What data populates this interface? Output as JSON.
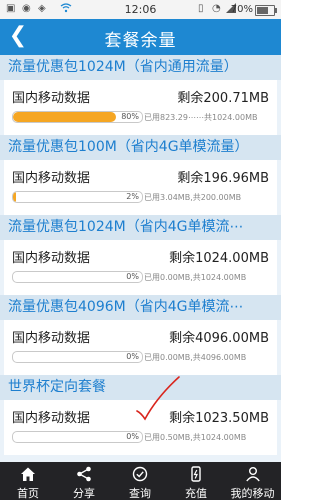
{
  "status": {
    "time": "12:06",
    "battery": "70%"
  },
  "header": {
    "back": "❮",
    "title": "套餐余量"
  },
  "packages": [
    {
      "title": "流量优惠包1024M（省内通用流量）",
      "label": "国内移动数据",
      "remain": "剩余200.71MB",
      "progress": 0.8,
      "percent": "80%",
      "used": "已用823.29⋯⋯共1024.00MB"
    },
    {
      "title": "流量优惠包100M（省内4G单模流量）",
      "label": "国内移动数据",
      "remain": "剩余196.96MB",
      "progress": 0.02,
      "percent": "2%",
      "used": "已用3.04MB,共200.00MB"
    },
    {
      "title": "流量优惠包1024M（省内4G单模流⋯",
      "label": "国内移动数据",
      "remain": "剩余1024.00MB",
      "progress": 0,
      "percent": "0%",
      "used": "已用0.00MB,共1024.00MB"
    },
    {
      "title": "流量优惠包4096M（省内4G单模流⋯",
      "label": "国内移动数据",
      "remain": "剩余4096.00MB",
      "progress": 0,
      "percent": "0%",
      "used": "已用0.00MB,共4096.00MB"
    },
    {
      "title": "世界杯定向套餐",
      "label": "国内移动数据",
      "remain": "剩余1023.50MB",
      "progress": 0,
      "percent": "0%",
      "used": "已用0.50MB,共1024.00MB"
    }
  ],
  "tabs": [
    {
      "label": "首页",
      "icon": "home-icon"
    },
    {
      "label": "分享",
      "icon": "share-icon"
    },
    {
      "label": "查询",
      "icon": "query-icon"
    },
    {
      "label": "充值",
      "icon": "recharge-icon"
    },
    {
      "label": "我的移动",
      "icon": "person-icon"
    }
  ],
  "colors": {
    "header": "#1e88d2",
    "accent": "#1e7fcf",
    "progress": "#f5a623",
    "tabbar": "#232326"
  }
}
